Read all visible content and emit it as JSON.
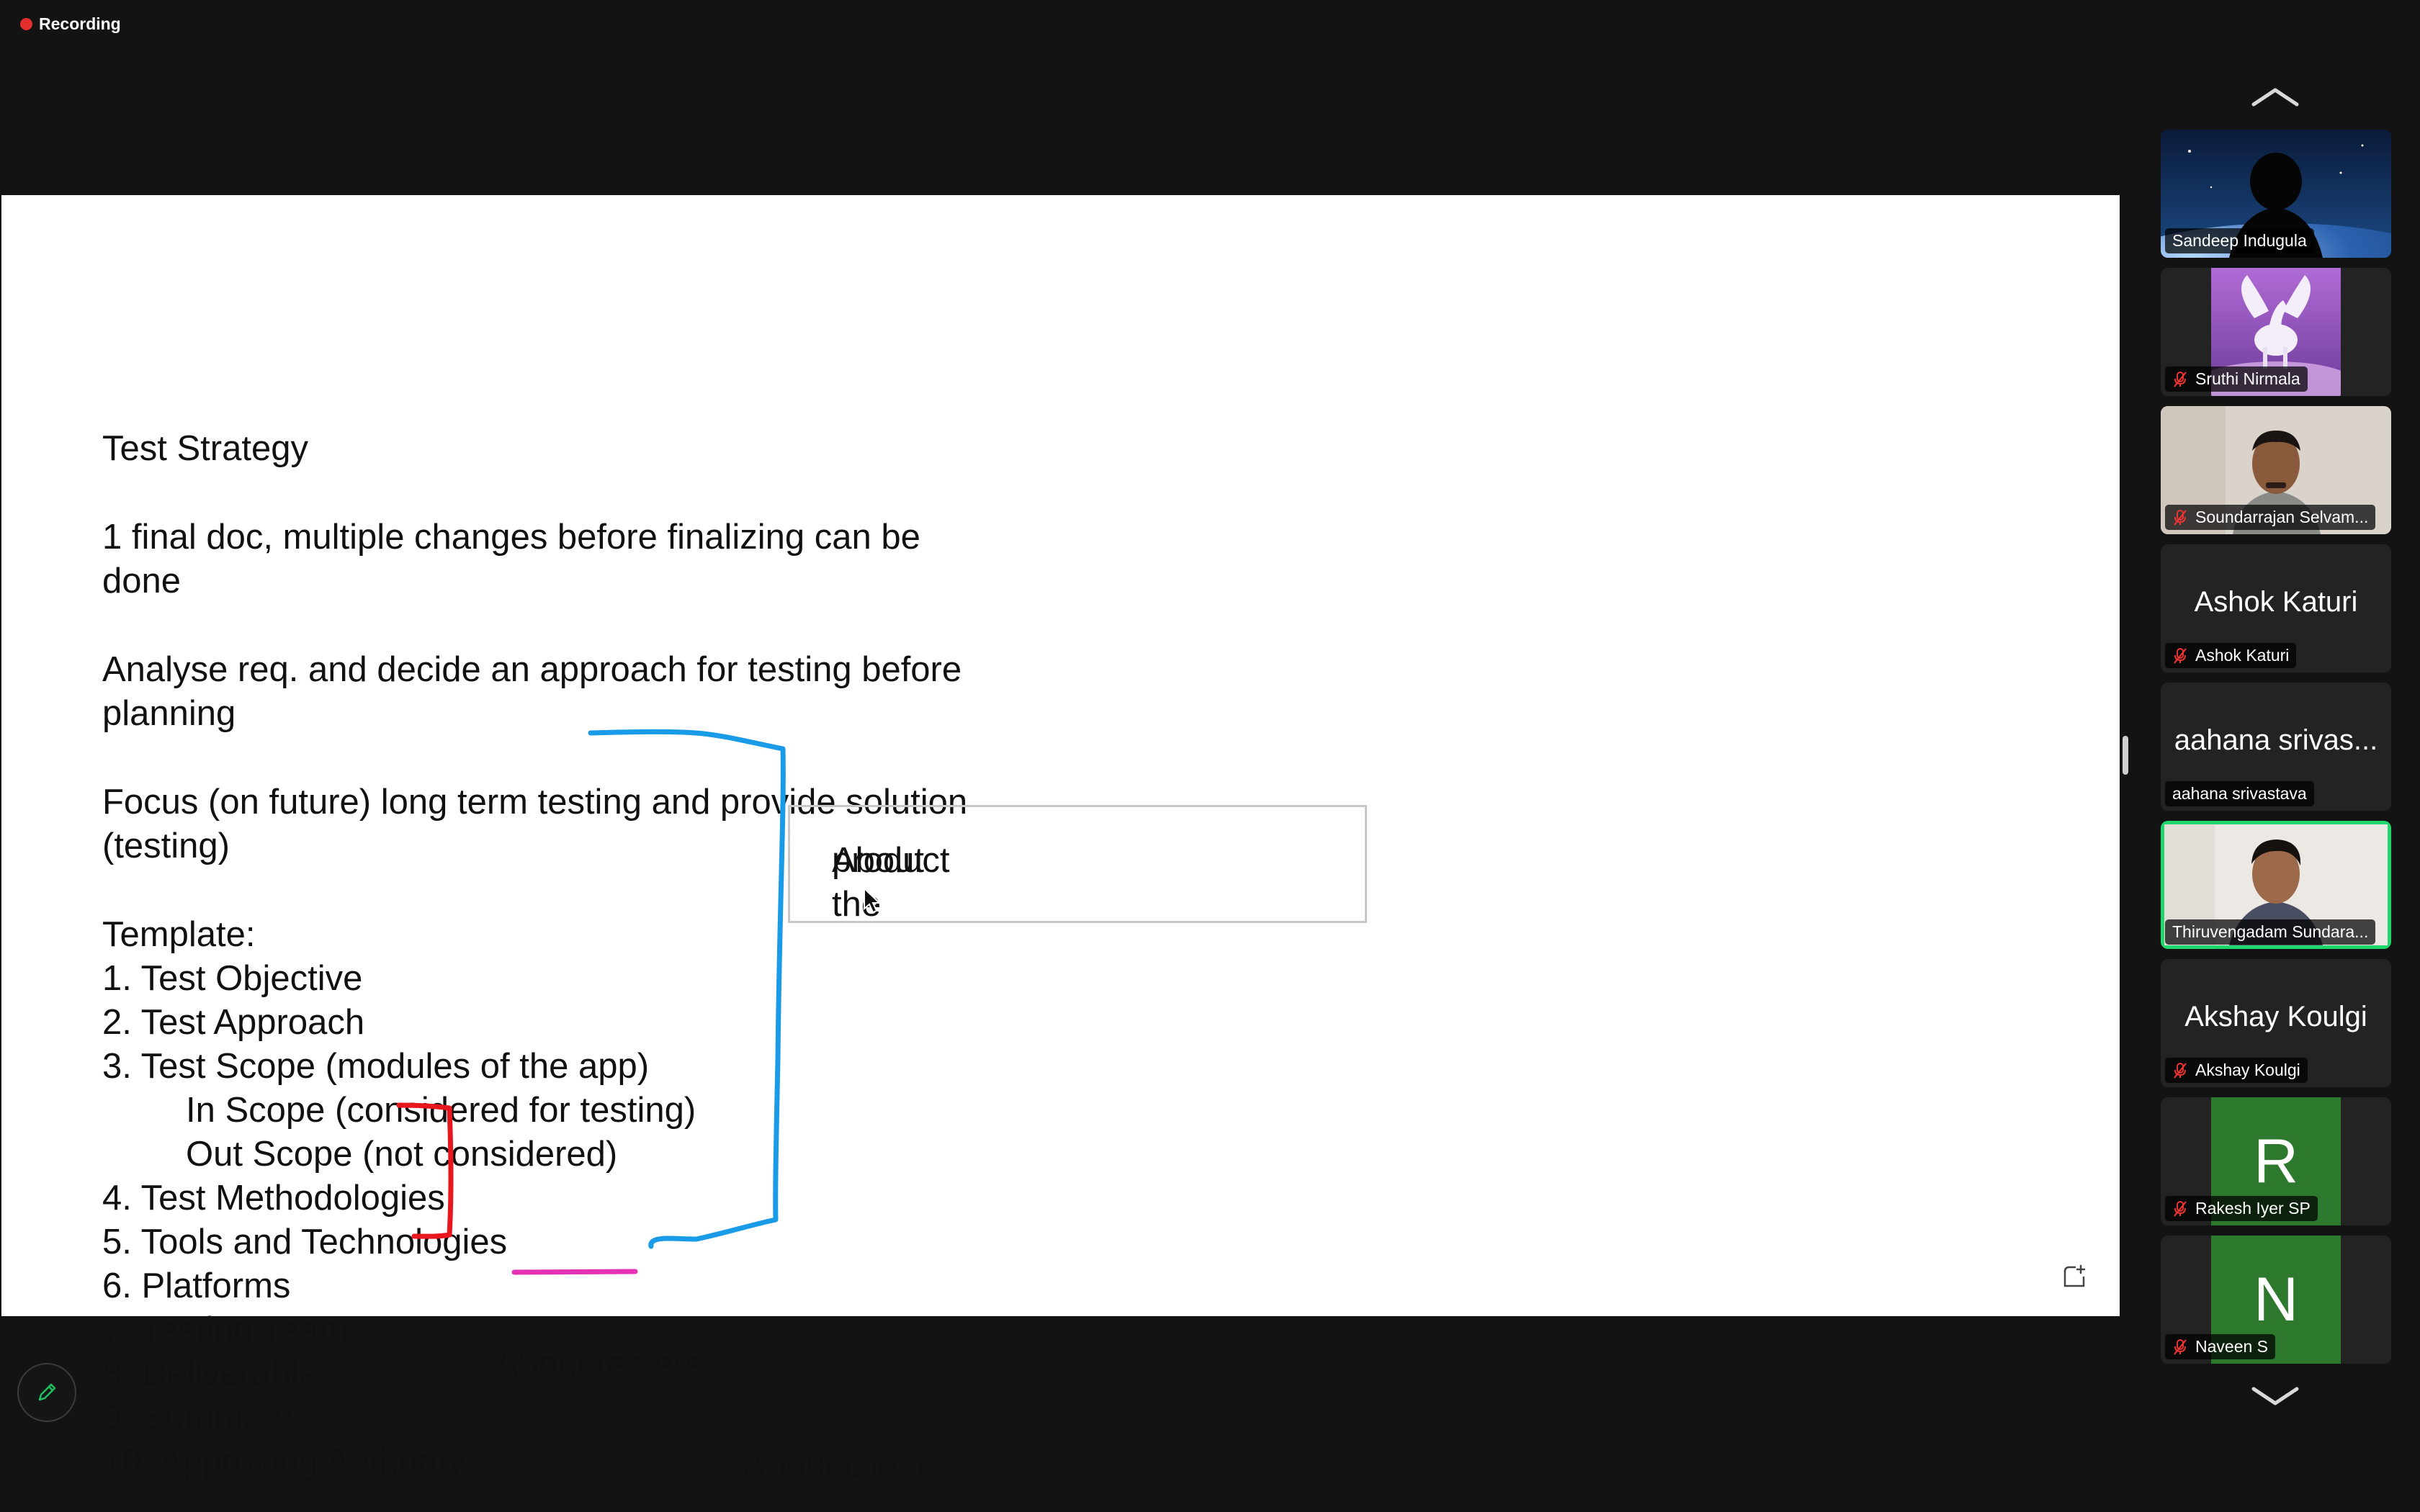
{
  "recording": {
    "label": "Recording"
  },
  "slide": {
    "lines": [
      "Test Strategy",
      "1 final doc, multiple changes before finalizing can be",
      "done",
      "Analyse req. and decide an approach for testing before",
      "planning",
      "Focus (on future) long term testing and provide solution",
      "(testing)",
      "Template:",
      "1. Test Objective",
      "2. Test Approach",
      "3. Test Scope (modules of the app)",
      "In Scope (considered for testing)",
      "Out Scope (not considered)",
      "4. Test Methodologies",
      "5. Tools and Technologies",
      "6. Platforms",
      "7. Testing Team",
      "8. Deliverables",
      "9. Summary",
      "10. Approving Authority"
    ],
    "product_box_line1": "About the",
    "product_box_line2": "product",
    "about_testers": "About testers",
    "about_client": "About client"
  },
  "annotation_colors": {
    "blue": "#1a9be8",
    "red": "#e8161d",
    "magenta": "#e532b5"
  },
  "participants": [
    {
      "name": "Sandeep Indugula",
      "muted": false,
      "video": true
    },
    {
      "name": "Sruthi Nirmala",
      "muted": true,
      "video": true
    },
    {
      "name": "Soundarrajan Selvam...",
      "muted": true,
      "video": true
    },
    {
      "name": "Ashok Katuri",
      "display": "Ashok Katuri",
      "muted": true,
      "video": false
    },
    {
      "name": "aahana srivastava",
      "display": "aahana srivas...",
      "muted": false,
      "video": false
    },
    {
      "name": "Thiruvengadam Sundara...",
      "muted": false,
      "video": true,
      "active_speaker": true
    },
    {
      "name": "Akshay Koulgi",
      "display": "Akshay Koulgi",
      "muted": true,
      "video": false
    },
    {
      "name": "Rakesh Iyer SP",
      "initial": "R",
      "muted": true,
      "video": false
    },
    {
      "name": "Naveen S",
      "initial": "N",
      "muted": true,
      "video": false
    }
  ]
}
